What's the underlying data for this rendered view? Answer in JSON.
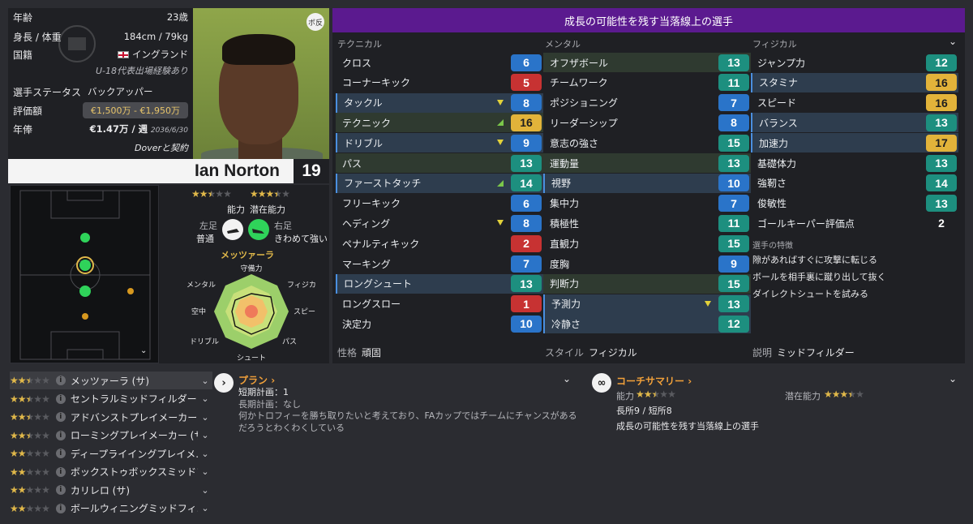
{
  "info": {
    "age_label": "年齢",
    "age_value": "23歳",
    "size_label": "身長 / 体重",
    "size_value": "184cm / 79kg",
    "nation_label": "国籍",
    "nation_value": "イングランド",
    "intl_note": "U-18代表出場経験あり",
    "status_label": "選手ステータス",
    "status_value": "バックアッパー",
    "value_label": "評価額",
    "value_range": "€1,500万 - €1,950万",
    "wage_label": "年俸",
    "wage_value": "€1.47万 / 週",
    "wage_expiry": "2036/6/30",
    "contract_note": "Doverと契約",
    "position_tag": "ボ反"
  },
  "player": {
    "name": "Ian Norton",
    "number": "19"
  },
  "ratings": {
    "ability_label": "能力",
    "potential_label": "潜在能力",
    "ability_stars": 2.5,
    "potential_stars": 3.5,
    "left_foot_label": "左足",
    "left_foot_value": "普通",
    "right_foot_label": "右足",
    "right_foot_value": "きわめて強い",
    "role": "メッツァーラ",
    "radar_labels": [
      "守備力",
      "フィジカル",
      "スピード",
      "パス",
      "シュート",
      "ドリブル",
      "空中",
      "メンタル"
    ]
  },
  "attributes": {
    "header": "成長の可能性を残す当落線上の選手",
    "col_technical": "テクニカル",
    "col_mental": "メンタル",
    "col_physical": "フィジカル",
    "technical": [
      {
        "name": "クロス",
        "value": "6",
        "color": "blue"
      },
      {
        "name": "コーナーキック",
        "value": "5",
        "color": "red"
      },
      {
        "name": "タックル",
        "value": "8",
        "color": "blue",
        "hl": true,
        "tri": "down"
      },
      {
        "name": "テクニック",
        "value": "16",
        "color": "gold",
        "hl": "green",
        "tri": "up"
      },
      {
        "name": "ドリブル",
        "value": "9",
        "color": "blue",
        "hl": true,
        "tri": "down"
      },
      {
        "name": "パス",
        "value": "13",
        "color": "teal",
        "hl": "green"
      },
      {
        "name": "ファーストタッチ",
        "value": "14",
        "color": "teal",
        "hl": true,
        "tri": "up"
      },
      {
        "name": "フリーキック",
        "value": "6",
        "color": "blue"
      },
      {
        "name": "ヘディング",
        "value": "8",
        "color": "blue",
        "tri": "down"
      },
      {
        "name": "ペナルティキック",
        "value": "2",
        "color": "red"
      },
      {
        "name": "マーキング",
        "value": "7",
        "color": "blue"
      },
      {
        "name": "ロングシュート",
        "value": "13",
        "color": "teal",
        "hl": true
      },
      {
        "name": "ロングスロー",
        "value": "1",
        "color": "red"
      },
      {
        "name": "決定力",
        "value": "10",
        "color": "blue"
      }
    ],
    "mental": [
      {
        "name": "オフザボール",
        "value": "13",
        "color": "teal",
        "hl": "green"
      },
      {
        "name": "チームワーク",
        "value": "11",
        "color": "teal"
      },
      {
        "name": "ポジショニング",
        "value": "7",
        "color": "blue"
      },
      {
        "name": "リーダーシップ",
        "value": "8",
        "color": "blue"
      },
      {
        "name": "意志の強さ",
        "value": "15",
        "color": "teal"
      },
      {
        "name": "運動量",
        "value": "13",
        "color": "teal",
        "hl": "green"
      },
      {
        "name": "視野",
        "value": "10",
        "color": "blue",
        "hl": true
      },
      {
        "name": "集中力",
        "value": "7",
        "color": "blue"
      },
      {
        "name": "積極性",
        "value": "11",
        "color": "teal"
      },
      {
        "name": "直観力",
        "value": "15",
        "color": "teal"
      },
      {
        "name": "度胸",
        "value": "9",
        "color": "blue"
      },
      {
        "name": "判断力",
        "value": "15",
        "color": "teal",
        "hl": "green"
      },
      {
        "name": "予測力",
        "value": "13",
        "color": "teal",
        "hl": true,
        "tri": "down"
      },
      {
        "name": "冷静さ",
        "value": "12",
        "color": "teal",
        "hl": true
      }
    ],
    "physical": [
      {
        "name": "ジャンプ力",
        "value": "12",
        "color": "teal"
      },
      {
        "name": "スタミナ",
        "value": "16",
        "color": "gold",
        "hl": true
      },
      {
        "name": "スピード",
        "value": "16",
        "color": "gold"
      },
      {
        "name": "バランス",
        "value": "13",
        "color": "teal",
        "hl": true
      },
      {
        "name": "加速力",
        "value": "17",
        "color": "gold",
        "hl": true
      },
      {
        "name": "基礎体力",
        "value": "13",
        "color": "teal"
      },
      {
        "name": "強靭さ",
        "value": "14",
        "color": "teal"
      },
      {
        "name": "俊敏性",
        "value": "13",
        "color": "teal"
      },
      {
        "name": "ゴールキーパー評価点",
        "value": "2",
        "color": "plain"
      }
    ],
    "traits_title": "選手の特徴",
    "traits": [
      "隙があればすぐに攻撃に転じる",
      "ボールを相手裏に蹴り出して抜く",
      "ダイレクトシュートを試みる"
    ],
    "personality_label": "性格",
    "personality_value": "頑固",
    "style_label": "スタイル",
    "style_value": "フィジカル",
    "description_label": "説明",
    "description_value": "ミッドフィルダー"
  },
  "roles": [
    {
      "label": "メッツァーラ (サ)",
      "stars": 2.5,
      "selected": true
    },
    {
      "label": "セントラルミッドフィルダー (...",
      "stars": 2.5
    },
    {
      "label": "アドバンストプレイメーカー (...",
      "stars": 2.5
    },
    {
      "label": "ローミングプレイメーカー (サ)",
      "stars": 2.5
    },
    {
      "label": "ディープライイングプレイメ...",
      "stars": 2
    },
    {
      "label": "ボックストゥボックスミッドフ...",
      "stars": 2
    },
    {
      "label": "カリレロ (サ)",
      "stars": 2
    },
    {
      "label": "ボールウィニングミッドフィ...",
      "stars": 2
    }
  ],
  "plan": {
    "title": "プラン",
    "short_term": "短期計画：1",
    "long_term": "長期計画：なし",
    "comment": "何かトロフィーを勝ち取りたいと考えており、FAカップではチームにチャンスがあるだろうとわくわくしている"
  },
  "coach": {
    "title": "コーチサマリー",
    "ability_label": "能力",
    "ability_stars": 2.5,
    "potential_label": "潜在能力",
    "potential_stars": 3.5,
    "strengths": "長所9 / 短所8",
    "summary": "成長の可能性を残す当落線上の選手"
  },
  "colors": {
    "accent": "#5b1a8f",
    "blue": "#2a74c9",
    "red": "#c73232",
    "teal": "#1d8f7f",
    "gold": "#e2b33a",
    "star": "#e0b84a"
  }
}
